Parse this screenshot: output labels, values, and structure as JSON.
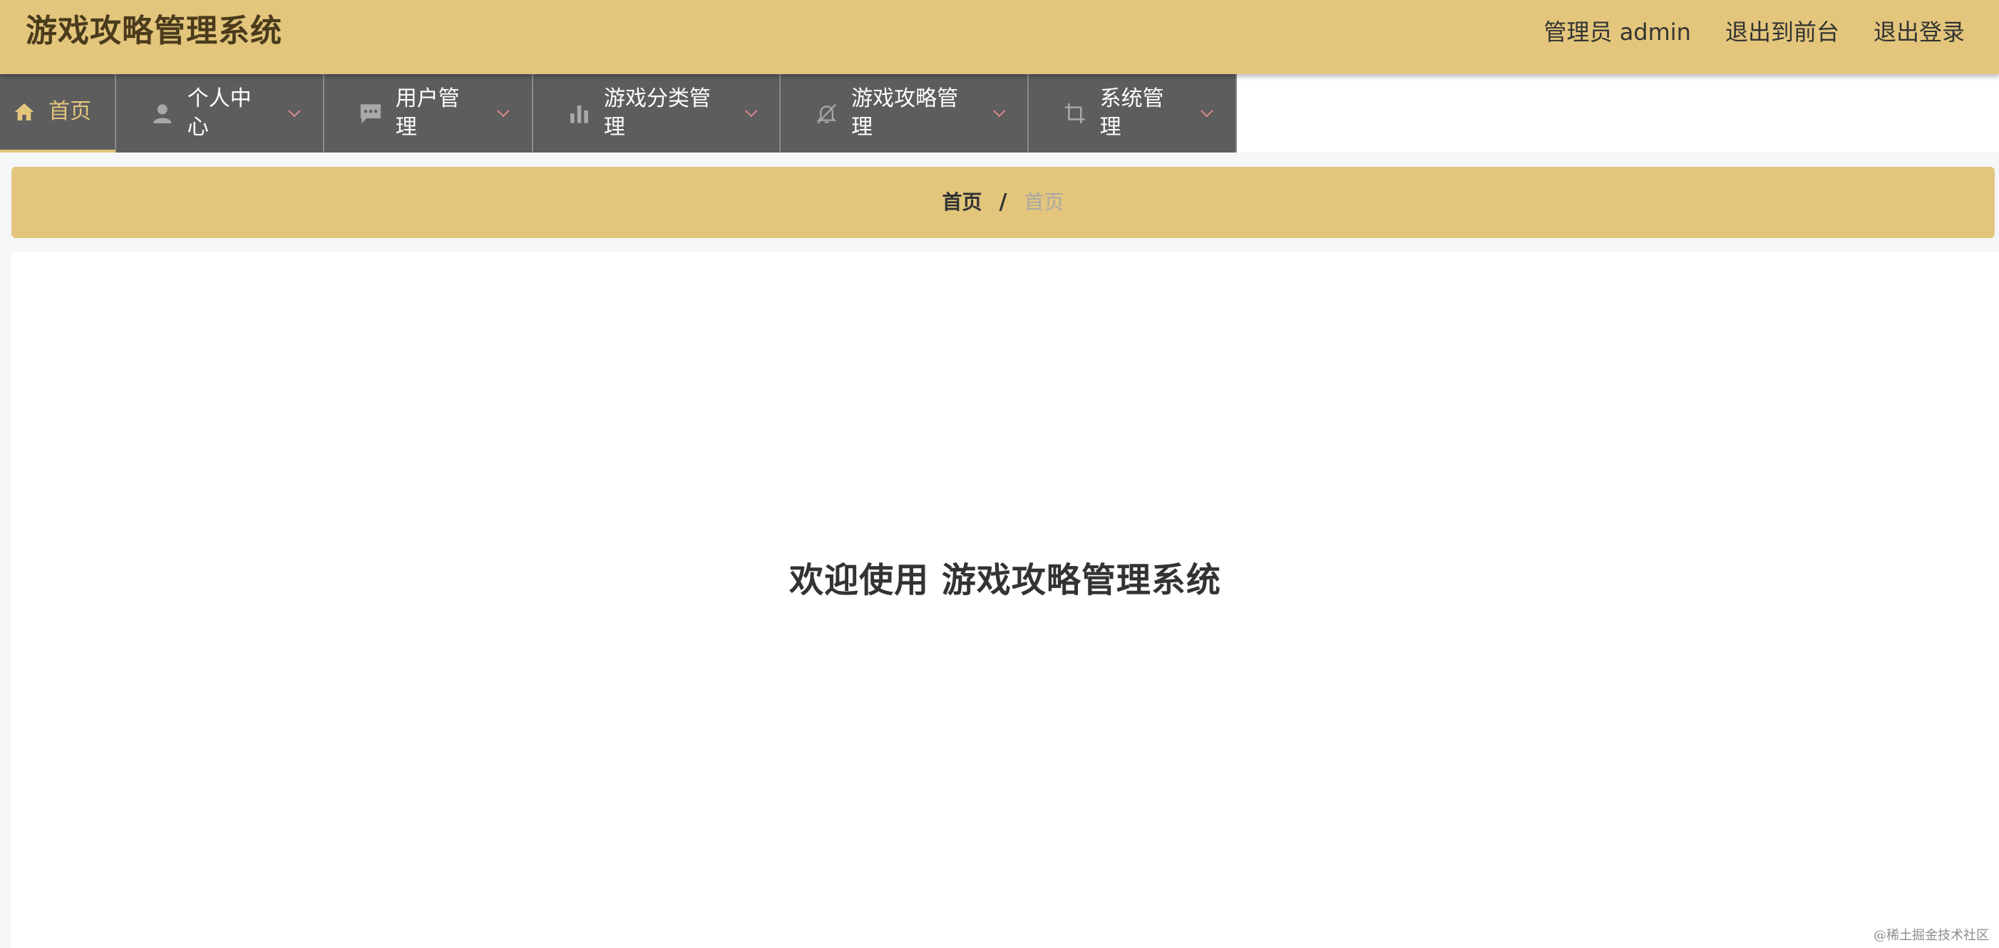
{
  "header": {
    "title": "游戏攻略管理系统",
    "user": "管理员 admin",
    "links": [
      {
        "label": "退出到前台"
      },
      {
        "label": "退出登录"
      }
    ]
  },
  "nav": {
    "items": [
      {
        "label": "首页",
        "icon": "home-icon",
        "active": true,
        "dropdown": false
      },
      {
        "label": "个人中心",
        "icon": "user-icon",
        "active": false,
        "dropdown": true
      },
      {
        "label": "用户管理",
        "icon": "chat-icon",
        "active": false,
        "dropdown": true
      },
      {
        "label": "游戏分类管理",
        "icon": "bar-chart-icon",
        "active": false,
        "dropdown": true
      },
      {
        "label": "游戏攻略管理",
        "icon": "bell-off-icon",
        "active": false,
        "dropdown": true
      },
      {
        "label": "系统管理",
        "icon": "crop-icon",
        "active": false,
        "dropdown": true
      }
    ]
  },
  "breadcrumb": {
    "home": "首页",
    "separator": "/",
    "current": "首页"
  },
  "main": {
    "welcome": "欢迎使用 游戏攻略管理系统"
  },
  "watermark": "@稀土掘金技术社区",
  "colors": {
    "header_bg": "#e3c67c",
    "nav_bg": "#5e5d5e",
    "active_text": "#e3c67c",
    "chevron": "#d98b8b"
  }
}
